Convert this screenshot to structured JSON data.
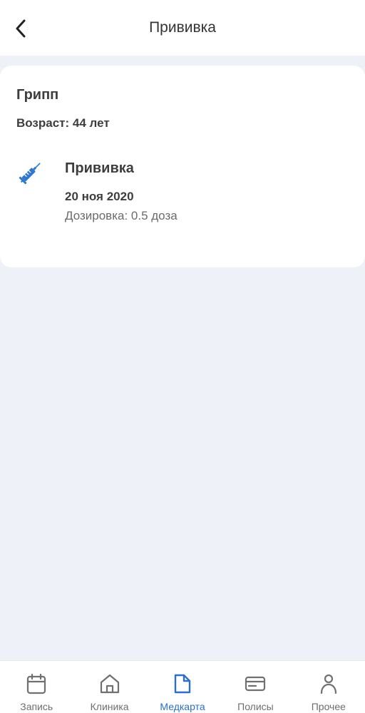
{
  "header": {
    "title": "Прививка",
    "back_icon": "chevron-left-icon"
  },
  "card": {
    "disease": "Грипп",
    "age": "Возраст: 44 лет",
    "entry": {
      "icon": "syringe-icon",
      "title": "Прививка",
      "date": "20 ноя 2020",
      "dosage": "Дозировка: 0.5 доза"
    }
  },
  "tabbar": {
    "active": "Медкарта",
    "items": [
      {
        "label": "Запись",
        "icon": "calendar-icon"
      },
      {
        "label": "Клиника",
        "icon": "home-icon"
      },
      {
        "label": "Медкарта",
        "icon": "document-icon"
      },
      {
        "label": "Полисы",
        "icon": "card-icon"
      },
      {
        "label": "Прочее",
        "icon": "person-icon"
      }
    ]
  },
  "colors": {
    "background": "#eef1f7",
    "surface": "#ffffff",
    "accent": "#2a6fcf",
    "syringe": "#2f78d0",
    "text_primary": "#3d3d3d",
    "text_secondary": "#6b6b6b"
  }
}
